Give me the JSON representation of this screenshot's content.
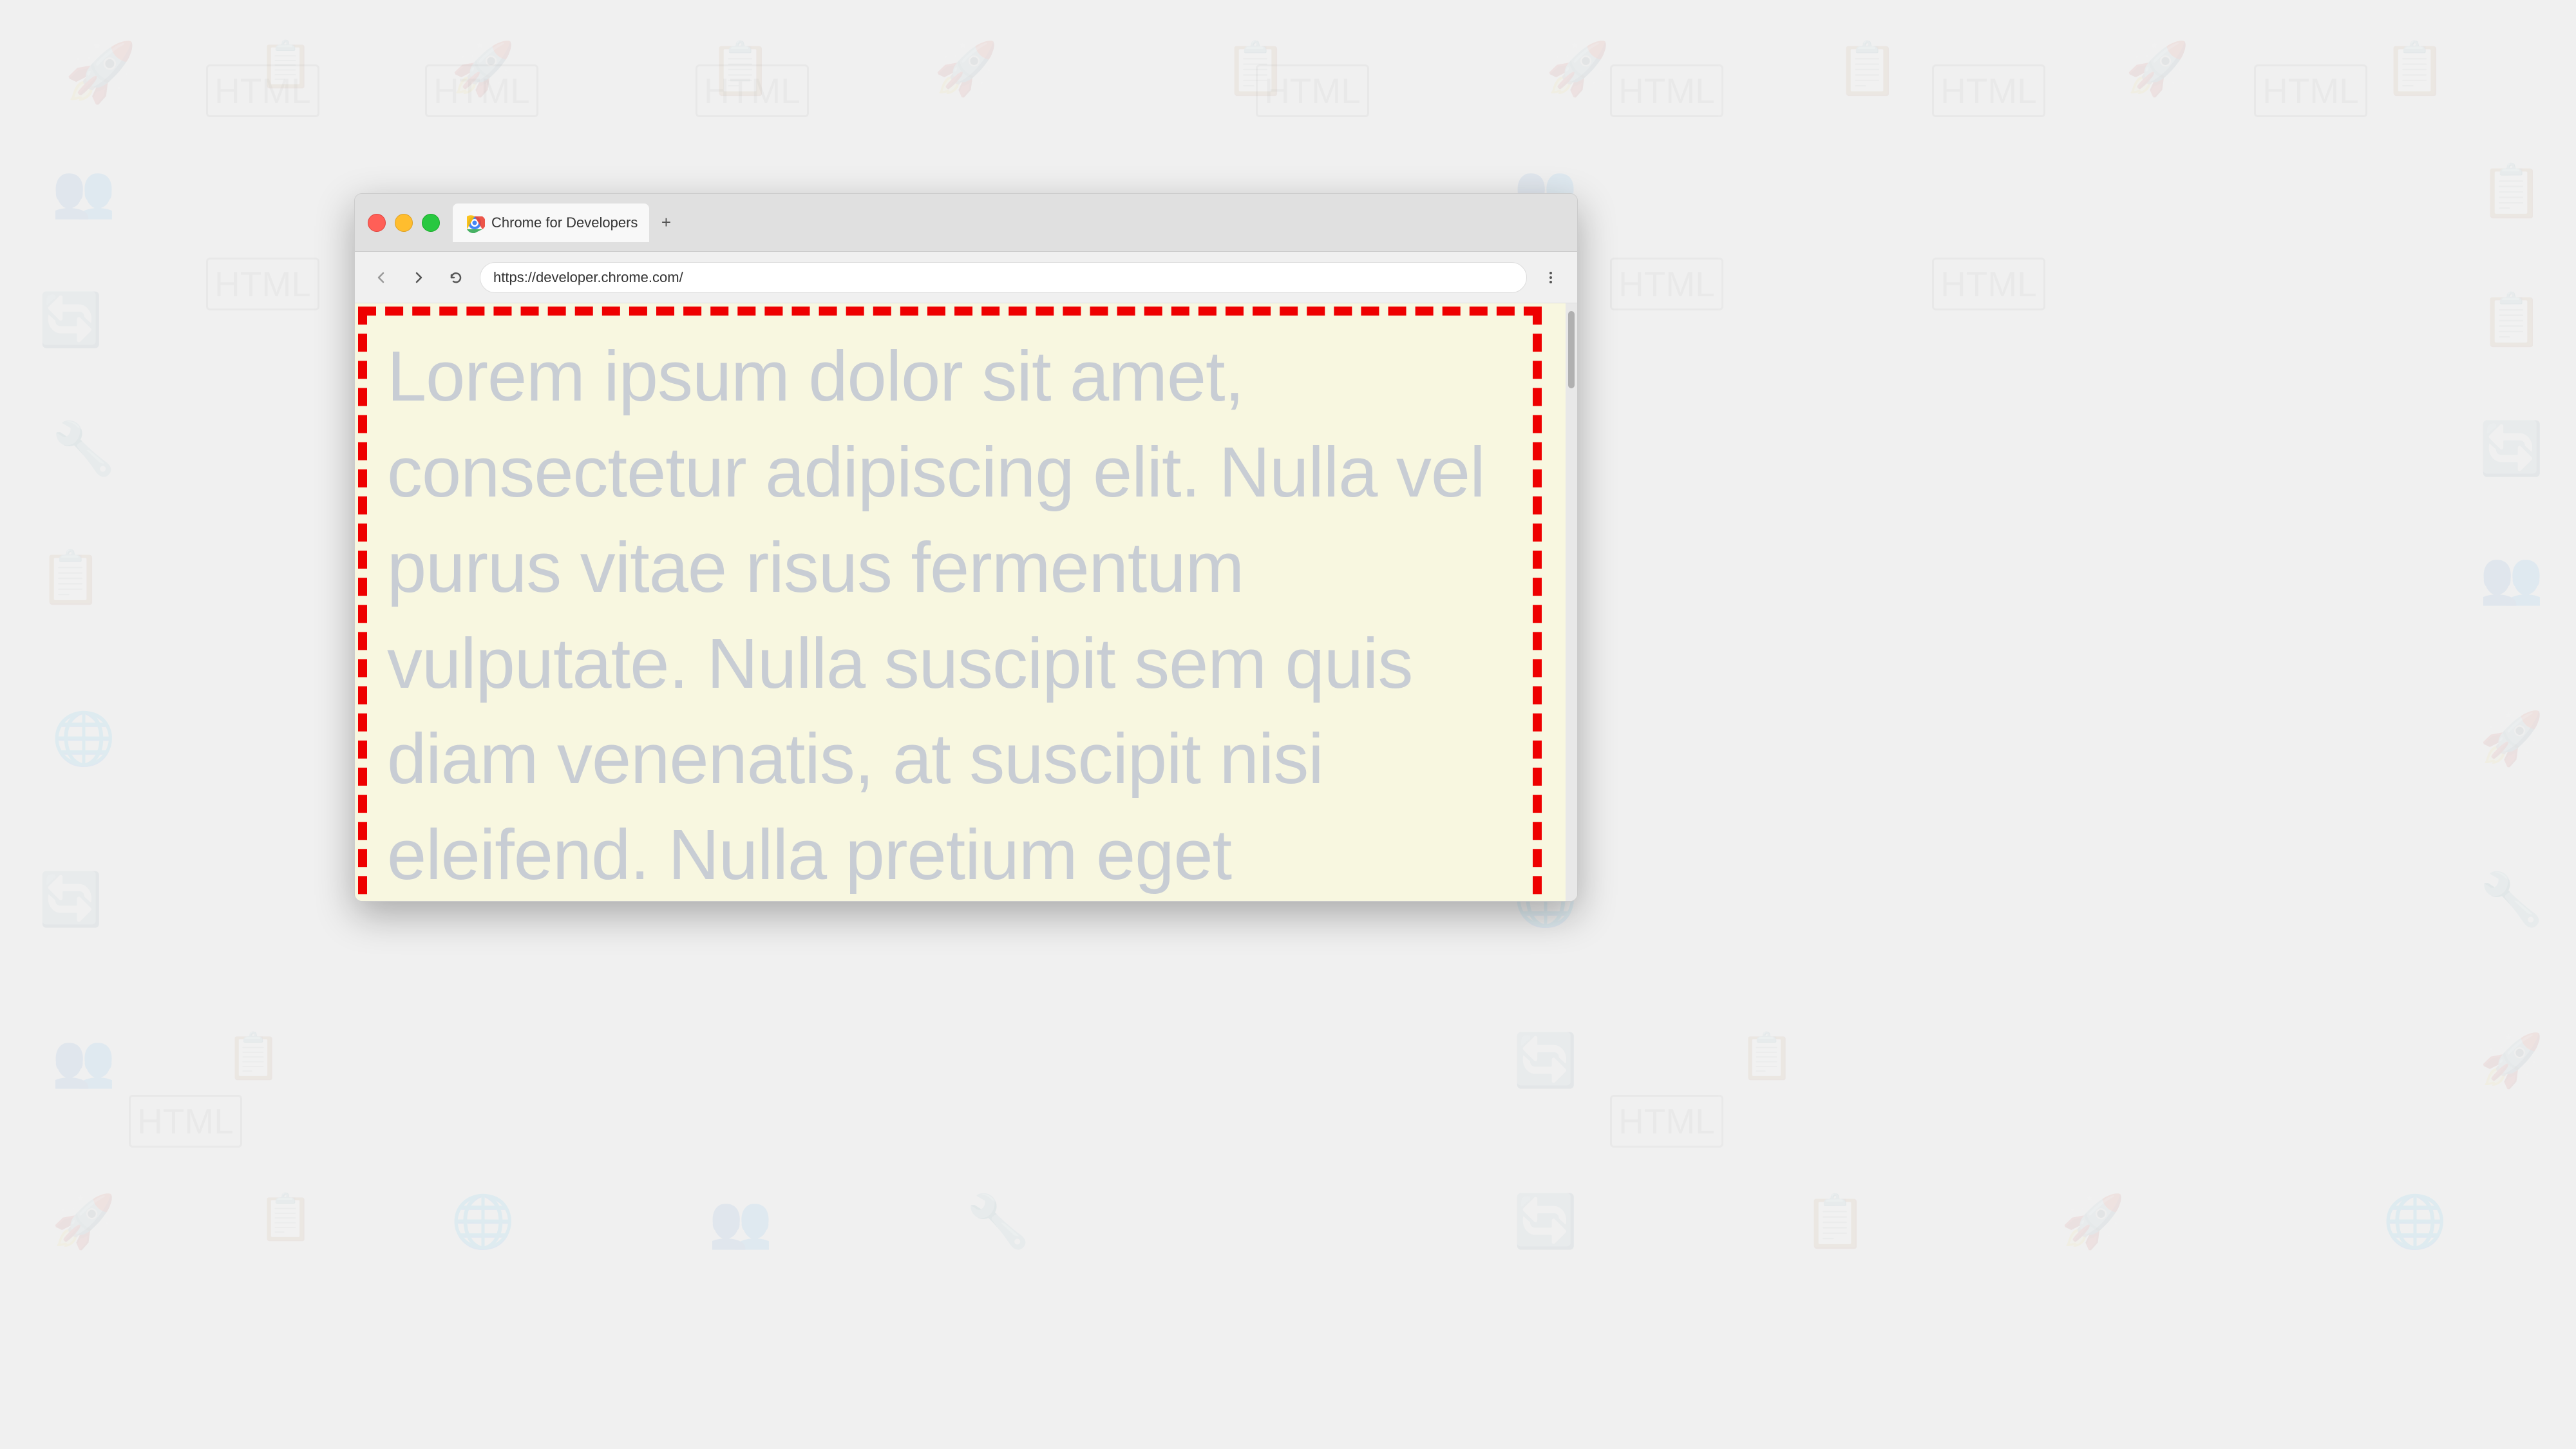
{
  "background": {
    "color": "#f0f0f0"
  },
  "browser": {
    "tab": {
      "title": "Chrome for Developers",
      "favicon": "chrome-icon"
    },
    "add_tab_label": "+",
    "address_bar": {
      "url": "https://developer.chrome.com/"
    },
    "nav": {
      "back_label": "←",
      "forward_label": "→",
      "reload_label": "↻",
      "menu_label": "⋮"
    },
    "page": {
      "lorem_text": "Lorem ipsum dolor sit amet, consectetur adipiscing elit. Nulla vel purus vitae risus fermentum vulputate. Nulla suscipit sem quis diam venenatis, at suscipit nisi eleifend. Nulla pretium eget",
      "background_color": "#f8f7e0"
    }
  }
}
